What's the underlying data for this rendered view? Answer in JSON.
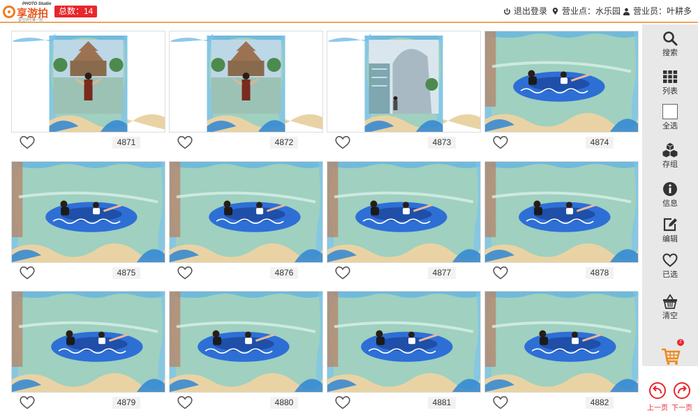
{
  "header": {
    "logo_small": "PHOTO Studio",
    "logo_main": "享游拍",
    "logo_sub": "留住快乐每一刻",
    "count_label": "总数：14",
    "logout": "退出登录",
    "location": "营业点：水乐园",
    "staff": "营业员：叶耕多"
  },
  "photos": [
    {
      "id": "4871",
      "scene": "temple-portrait"
    },
    {
      "id": "4872",
      "scene": "temple-portrait"
    },
    {
      "id": "4873",
      "scene": "building-portrait"
    },
    {
      "id": "4874",
      "scene": "raft-portrait"
    },
    {
      "id": "4875",
      "scene": "raft-wide"
    },
    {
      "id": "4876",
      "scene": "raft-wide"
    },
    {
      "id": "4877",
      "scene": "raft-wide"
    },
    {
      "id": "4878",
      "scene": "raft-wide"
    },
    {
      "id": "4879",
      "scene": "raft-wide"
    },
    {
      "id": "4880",
      "scene": "raft-wide"
    },
    {
      "id": "4881",
      "scene": "raft-wide"
    },
    {
      "id": "4882",
      "scene": "raft-wide"
    }
  ],
  "sidebar": {
    "search": "搜索",
    "list": "列表",
    "select_all": "全选",
    "save_group": "存组",
    "info": "信息",
    "edit": "编辑",
    "selected": "已选",
    "clear": "清空"
  },
  "cart": {
    "count": "2"
  },
  "pager": {
    "prev": "上一页",
    "next": "下一页"
  },
  "colors": {
    "accent": "#e8262b",
    "brand": "#ef7d1f",
    "water": "#9fd0c0",
    "raft": "#2e6fd6"
  }
}
